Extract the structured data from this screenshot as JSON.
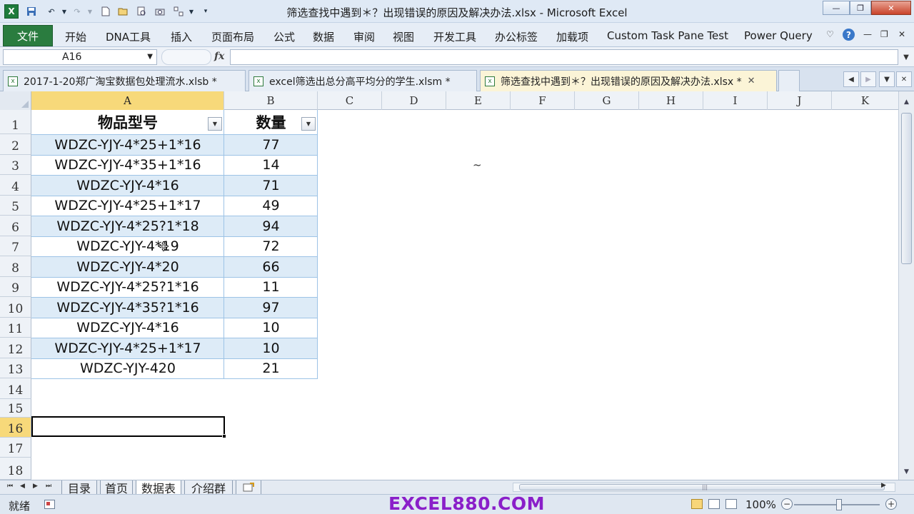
{
  "window": {
    "title": "筛选查找中遇到＊？出现错误的原因及解决办法.xlsx - Microsoft Excel"
  },
  "quick_access": [
    "save-icon",
    "undo-icon",
    "redo-icon",
    "new-icon",
    "open-icon",
    "print-preview-icon",
    "camera-icon",
    "sort-icon",
    "customize-icon"
  ],
  "ribbon": {
    "file_label": "文件",
    "tabs": [
      "开始",
      "DNA工具",
      "插入",
      "页面布局",
      "公式",
      "数据",
      "审阅",
      "视图",
      "开发工具",
      "办公标签",
      "加载项",
      "Custom Task Pane Test",
      "Power Query"
    ]
  },
  "formula_bar": {
    "name_box": "A16",
    "fx_label": "fx",
    "value": ""
  },
  "workbook_tabs": [
    {
      "label": "2017-1-20郑广淘宝数据包处理流水.xlsb *",
      "active": false
    },
    {
      "label": "excel筛选出总分高平均分的学生.xlsm *",
      "active": false
    },
    {
      "label": "筛选查找中遇到＊？出现错误的原因及解决办法.xlsx *",
      "active": true
    }
  ],
  "grid": {
    "columns": [
      "A",
      "B",
      "C",
      "D",
      "E",
      "F",
      "G",
      "H",
      "I",
      "J",
      "K"
    ],
    "rows": [
      "1",
      "2",
      "3",
      "4",
      "5",
      "6",
      "7",
      "8",
      "9",
      "10",
      "11",
      "12",
      "13",
      "14",
      "15",
      "16",
      "17",
      "18"
    ],
    "header": {
      "a": "物品型号",
      "b": "数量"
    },
    "data": [
      {
        "a": "WDZC-YJY-4*25+1*16",
        "b": "77"
      },
      {
        "a": "WDZC-YJY-4*35+1*16",
        "b": "14"
      },
      {
        "a": "WDZC-YJY-4*16",
        "b": "71"
      },
      {
        "a": "WDZC-YJY-4*25+1*17",
        "b": "49"
      },
      {
        "a": "WDZC-YJY-4*25?1*18",
        "b": "94"
      },
      {
        "a": "WDZC-YJY-4*19",
        "b": "72"
      },
      {
        "a": "WDZC-YJY-4*20",
        "b": "66"
      },
      {
        "a": "WDZC-YJY-4*25?1*16",
        "b": "11"
      },
      {
        "a": "WDZC-YJY-4*35?1*16",
        "b": "97"
      },
      {
        "a": "WDZC-YJY-4*16",
        "b": "10"
      },
      {
        "a": "WDZC-YJY-4*25+1*17",
        "b": "10"
      },
      {
        "a": "WDZC-YJY-420",
        "b": "21"
      }
    ],
    "stray_text": "~",
    "active_cell": "A16"
  },
  "sheets": [
    {
      "label": "目录",
      "active": false
    },
    {
      "label": "首页",
      "active": false
    },
    {
      "label": "数据表",
      "active": true
    },
    {
      "label": "介绍群",
      "active": false
    }
  ],
  "status": {
    "ready": "就绪",
    "watermark": "EXCEL880.COM",
    "zoom": "100%"
  },
  "colors": {
    "file_tab": "#2a7c3f",
    "selected_header": "#f7d97a",
    "table_band": "#ddebf7",
    "watermark": "#8a1fc9"
  }
}
